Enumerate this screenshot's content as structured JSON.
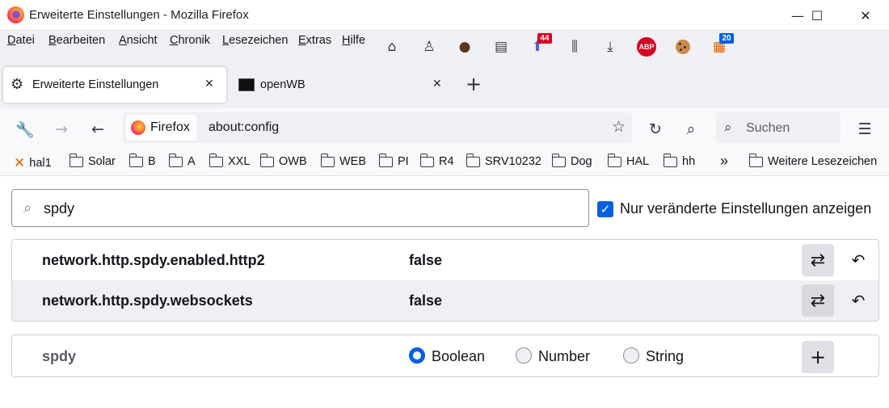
{
  "window": {
    "title": "Erweiterte Einstellungen - Mozilla Firefox",
    "controls": {
      "minimize": "—",
      "maximize": "☐",
      "close": "✕"
    }
  },
  "menubar": {
    "items": [
      {
        "acc": "D",
        "rest": "atei"
      },
      {
        "acc": "B",
        "rest": "earbeiten"
      },
      {
        "acc": "A",
        "rest": "nsicht"
      },
      {
        "acc": "C",
        "rest": "hronik"
      },
      {
        "acc": "L",
        "rest": "esezeichen"
      },
      {
        "acc": "E",
        "rest": "xtras"
      },
      {
        "acc": "H",
        "rest": "ilfe"
      }
    ],
    "toolbar_icons": [
      {
        "name": "home-icon",
        "glyph": "⌂"
      },
      {
        "name": "extension-character-icon",
        "glyph": "♙"
      },
      {
        "name": "extension-avatar-icon",
        "glyph": "●"
      },
      {
        "name": "reader-sidebar-icon",
        "glyph": "▤"
      },
      {
        "name": "arrow-up-extension-icon",
        "glyph": "⬆",
        "badge": "44",
        "badge_color": "#d70022"
      },
      {
        "name": "library-icon",
        "glyph": "⫼"
      },
      {
        "name": "downloads-icon",
        "glyph": "⤓"
      },
      {
        "name": "adblock-plus-icon",
        "glyph": "ABP"
      },
      {
        "name": "cookie-icon",
        "glyph": "🍪"
      },
      {
        "name": "calendar-extension-icon",
        "glyph": "▦",
        "badge": "20",
        "badge_color": "#0060df"
      }
    ]
  },
  "tabs": [
    {
      "label": "Erweiterte Einstellungen",
      "active": true,
      "icon": "gear-icon"
    },
    {
      "label": "openWB",
      "active": false,
      "icon": "openwb-favicon"
    }
  ],
  "tab_controls": {
    "close": "✕",
    "new_tab": "+"
  },
  "navbar": {
    "identity_label": "Firefox",
    "url": "about:config",
    "search_placeholder": "Suchen"
  },
  "bookmarks": {
    "items": [
      {
        "label": "hal1",
        "icon": "hal-x-icon"
      },
      {
        "label": "Solar",
        "icon": "folder-icon"
      },
      {
        "label": "B",
        "icon": "folder-icon"
      },
      {
        "label": "A",
        "icon": "folder-icon"
      },
      {
        "label": "XXL",
        "icon": "folder-icon"
      },
      {
        "label": "OWB",
        "icon": "folder-icon"
      },
      {
        "label": "WEB",
        "icon": "folder-icon"
      },
      {
        "label": "PI",
        "icon": "folder-icon"
      },
      {
        "label": "R4",
        "icon": "folder-icon"
      },
      {
        "label": "SRV10232",
        "icon": "folder-icon"
      },
      {
        "label": "Dog",
        "icon": "folder-icon"
      },
      {
        "label": "HAL",
        "icon": "folder-icon"
      },
      {
        "label": "hh",
        "icon": "folder-icon"
      }
    ],
    "overflow": "»",
    "other_label": "Weitere Lesezeichen"
  },
  "config": {
    "search_value": "spdy",
    "modified_only_label": "Nur veränderte Einstellungen anzeigen",
    "modified_only_checked": true,
    "prefs": [
      {
        "name": "network.http.spdy.enabled.http2",
        "value": "false"
      },
      {
        "name": "network.http.spdy.websockets",
        "value": "false"
      }
    ],
    "new_pref": {
      "name": "spdy",
      "types": [
        {
          "label": "Boolean",
          "selected": true
        },
        {
          "label": "Number",
          "selected": false
        },
        {
          "label": "String",
          "selected": false
        }
      ]
    },
    "accent_color": "#0061e0"
  }
}
